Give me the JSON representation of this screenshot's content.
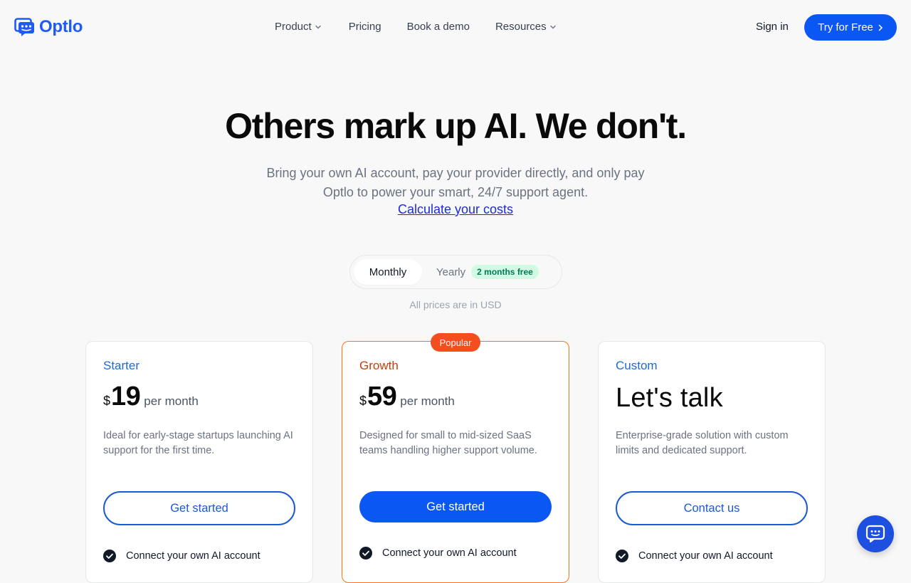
{
  "brand": {
    "name": "Optlo",
    "color": "#1e5bf5"
  },
  "nav": {
    "links": [
      {
        "label": "Product",
        "has_dropdown": true
      },
      {
        "label": "Pricing",
        "has_dropdown": false
      },
      {
        "label": "Book a demo",
        "has_dropdown": false
      },
      {
        "label": "Resources",
        "has_dropdown": true
      }
    ],
    "sign_in": "Sign in",
    "cta": "Try for Free"
  },
  "hero": {
    "title": "Others mark up AI. We don't.",
    "subtitle_line1": "Bring your own AI account, pay your provider directly, and only pay",
    "subtitle_line2": "Optlo to power your smart, 24/7 support agent.",
    "link": "Calculate your costs"
  },
  "billing_toggle": {
    "monthly": "Monthly",
    "yearly": "Yearly",
    "yearly_badge": "2 months free",
    "selected": "Monthly"
  },
  "currency_note": "All prices are in USD",
  "plans": [
    {
      "name": "Starter",
      "currency": "$",
      "price": "19",
      "period": "per month",
      "description": "Ideal for early-stage startups launching AI support for the first time.",
      "cta": "Get started",
      "features": [
        "Connect your own AI account"
      ]
    },
    {
      "name": "Growth",
      "badge": "Popular",
      "currency": "$",
      "price": "59",
      "period": "per month",
      "description": "Designed for small to mid-sized SaaS teams handling higher support volume.",
      "cta": "Get started",
      "features": [
        "Connect your own AI account"
      ]
    },
    {
      "name": "Custom",
      "price_text": "Let's talk",
      "description": "Enterprise-grade solution with custom limits and dedicated support.",
      "cta": "Contact us",
      "features": [
        "Connect your own AI account"
      ]
    }
  ],
  "colors": {
    "primary": "#0b57f4",
    "popular_badge": "#f44d1e",
    "growth_border": "#f97316",
    "free_badge_bg": "#d1fae5",
    "free_badge_text": "#047857"
  },
  "icons": {
    "chat_widget": "chat-bubble-icon",
    "check": "check-circle-icon",
    "dropdown": "chevron-down-icon"
  }
}
